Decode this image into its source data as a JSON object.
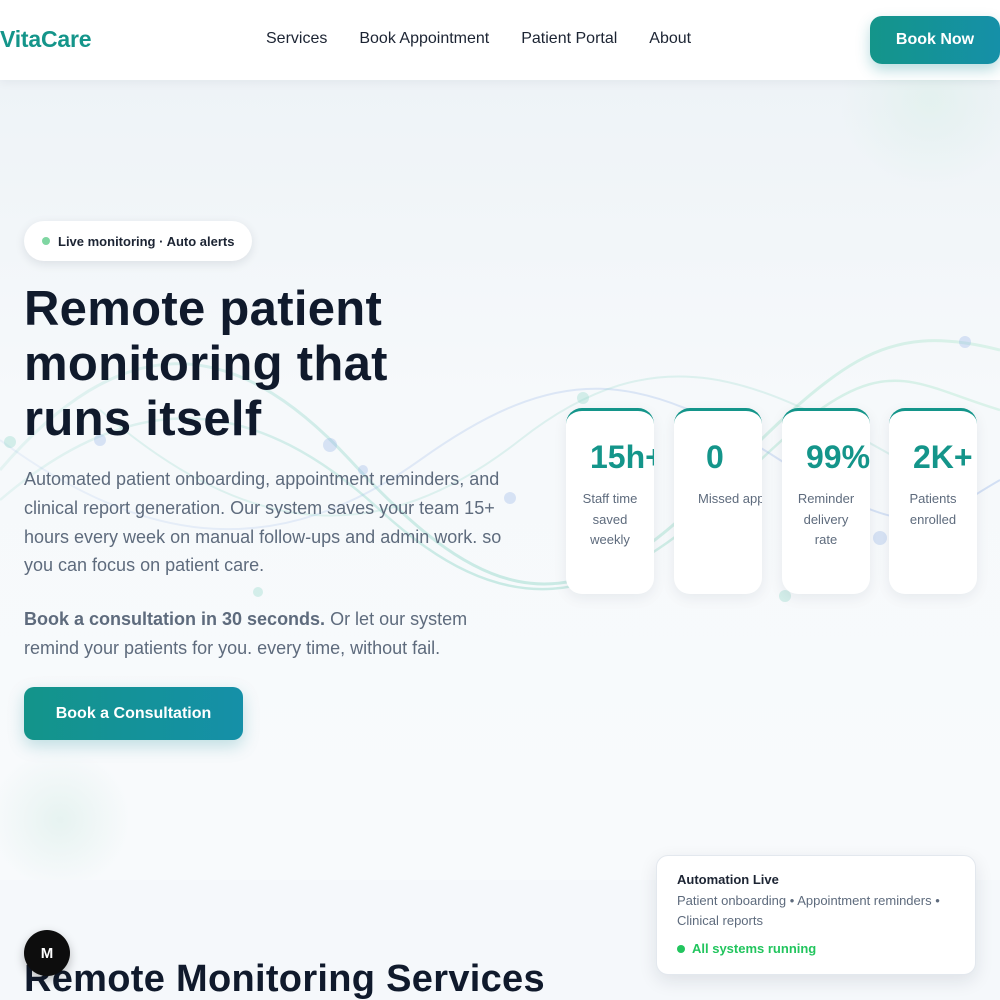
{
  "header": {
    "logo": "VitaCare",
    "nav": {
      "services": "Services",
      "book_appointment": "Book Appointment",
      "patient_portal": "Patient Portal",
      "about": "About"
    },
    "book_now": "Book Now"
  },
  "hero": {
    "badge": "Live monitoring · Auto alerts",
    "title_line1": "Remote patient",
    "title_line2": "monitoring that",
    "title_line3": "runs itself",
    "description": "Automated patient onboarding, appointment reminders, and clinical report generation. Our system saves your team 15+ hours every week on manual follow-ups and admin work. so you can focus on patient care.",
    "cta_bold": "Book a consultation in 30 seconds.",
    "cta_rest": " Or let our system remind your patients for you. every time, without fail.",
    "button": "Book a Consultation"
  },
  "stats": [
    {
      "value": "15h+",
      "label": "Staff time saved weekly"
    },
    {
      "value": "0",
      "label": "Missed appointments"
    },
    {
      "value": "99%",
      "label": "Reminder delivery rate"
    },
    {
      "value": "2K+",
      "label": "Patients enrolled"
    }
  ],
  "services_section": {
    "title": "Remote Monitoring Services"
  },
  "automation_panel": {
    "title": "Automation Live",
    "description": "Patient onboarding • Appointment reminders • Clinical reports",
    "status": "All systems running"
  },
  "fab": {
    "label": "M"
  },
  "colors": {
    "brand": "#14958a",
    "status_ok": "#22c55e",
    "text_dark": "#101a2c",
    "text_muted": "#5e6b7d"
  }
}
